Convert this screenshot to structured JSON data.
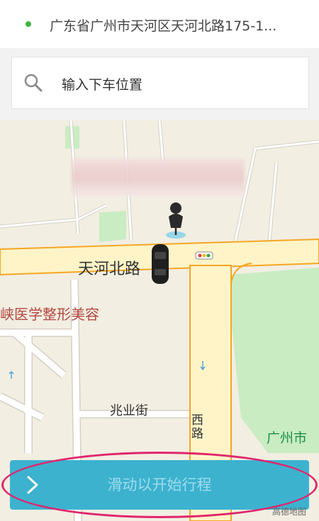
{
  "origin": {
    "address": "广东省广州市天河区天河北路175-1..."
  },
  "destination_search": {
    "placeholder": "输入下车位置"
  },
  "map": {
    "road_main": "天河北路",
    "poi_name": "峡医学整形美容",
    "street_name": "兆业街",
    "vertical_road": "西路",
    "district": "广州市",
    "logo": "高德地图"
  },
  "slide_action": {
    "label": "滑动以开始行程"
  },
  "colors": {
    "accent": "#3cb2cf",
    "origin_dot": "#3fb43f",
    "highlight": "#e0266c",
    "road": "#fff4c8",
    "road_edge": "#f5a623",
    "green_area": "#c9ecc3"
  }
}
